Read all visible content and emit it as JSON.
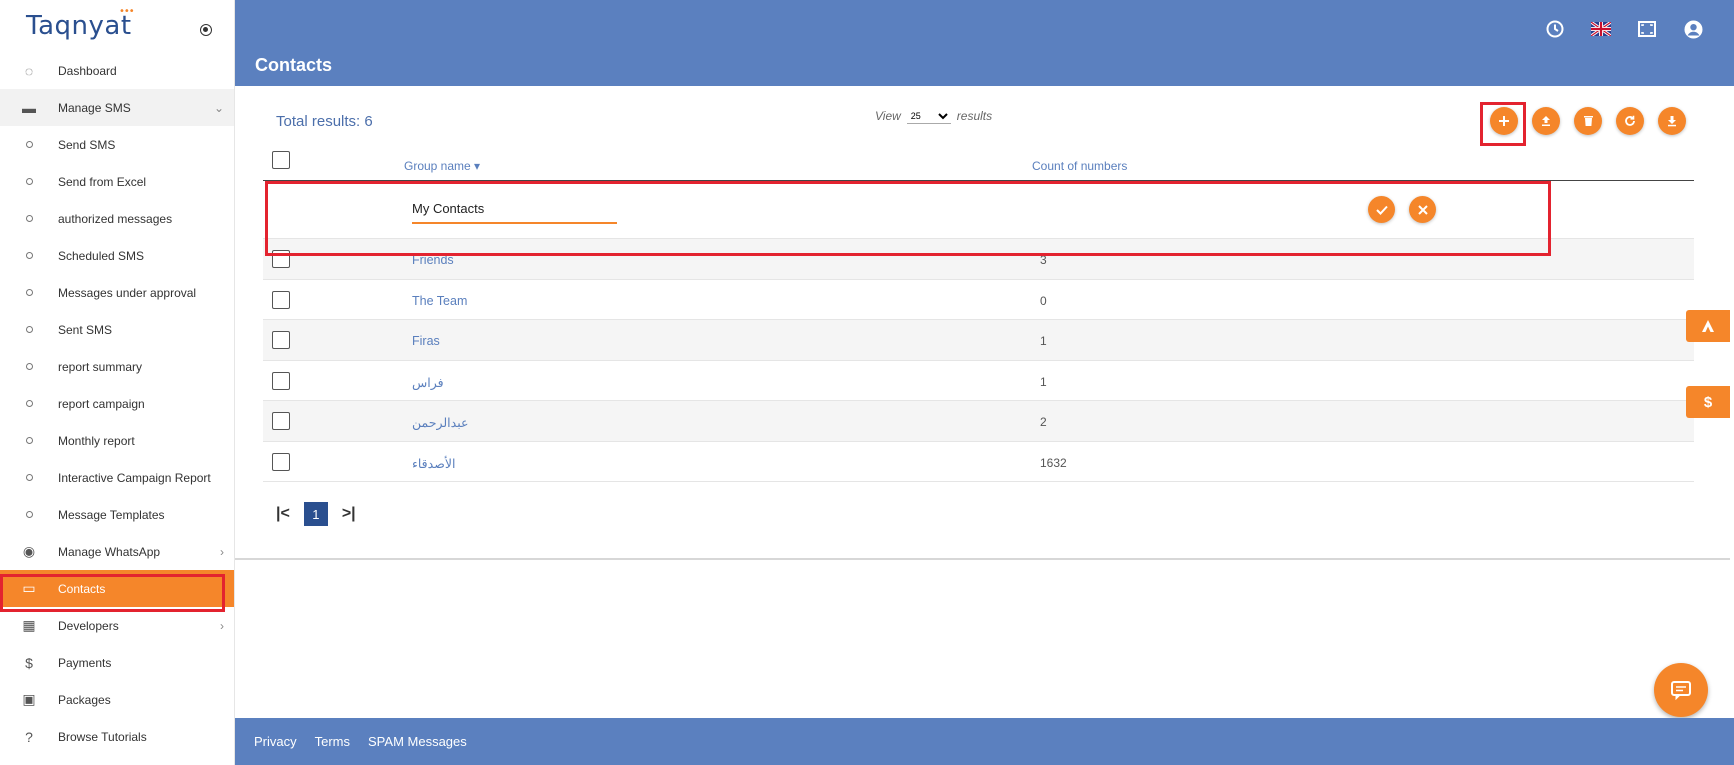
{
  "brand": {
    "logo_text": "Taqnyat",
    "logo_dots": "•••"
  },
  "sidebar": {
    "items": [
      {
        "label": "Dashboard",
        "icon": "dashboard-icon",
        "glyph": "◌"
      },
      {
        "label": "Manage SMS",
        "icon": "sms-icon",
        "glyph": "▬",
        "chevron": "⌄"
      },
      {
        "label": "Send SMS"
      },
      {
        "label": "Send from Excel"
      },
      {
        "label": "authorized messages"
      },
      {
        "label": "Scheduled SMS"
      },
      {
        "label": "Messages under approval"
      },
      {
        "label": "Sent SMS"
      },
      {
        "label": "report summary"
      },
      {
        "label": "report campaign"
      },
      {
        "label": "Monthly report"
      },
      {
        "label": "Interactive Campaign Report"
      },
      {
        "label": "Message Templates"
      },
      {
        "label": "Manage WhatsApp",
        "icon": "whatsapp-icon",
        "glyph": "◉",
        "chevron": "›"
      },
      {
        "label": "Contacts",
        "icon": "book-icon",
        "glyph": "▭"
      },
      {
        "label": "Developers",
        "icon": "developers-icon",
        "glyph": "▦",
        "chevron": "›"
      },
      {
        "label": "Payments",
        "icon": "dollar-icon",
        "glyph": "$"
      },
      {
        "label": "Packages",
        "icon": "package-icon",
        "glyph": "▣"
      },
      {
        "label": "Browse Tutorials",
        "icon": "help-icon",
        "glyph": "?"
      }
    ]
  },
  "header": {
    "title": "Contacts",
    "icons": [
      "clock-icon",
      "uk-flag-icon",
      "fullscreen-icon",
      "user-icon"
    ]
  },
  "main": {
    "total_results": "Total results: 6",
    "view_label": "View",
    "view_value": "25",
    "results_label": "results",
    "columns": {
      "group_name": "Group name",
      "count": "Count of numbers"
    },
    "new_group_value": "My Contacts",
    "rows": [
      {
        "name": "Friends",
        "count": "3"
      },
      {
        "name": "The Team",
        "count": "0"
      },
      {
        "name": "Firas",
        "count": "1"
      },
      {
        "name": "فراس",
        "count": "1"
      },
      {
        "name": "عبدالرحمن",
        "count": "2"
      },
      {
        "name": "الأصدقاء",
        "count": "1632"
      }
    ],
    "pager": {
      "first": "|<",
      "current": "1",
      "last": ">|"
    }
  },
  "footer": {
    "links": [
      "Privacy",
      "Terms",
      "SPAM Messages"
    ]
  },
  "colors": {
    "accent": "#f5862a",
    "brand_blue": "#5b80bf",
    "highlight_red": "#e3232f"
  }
}
